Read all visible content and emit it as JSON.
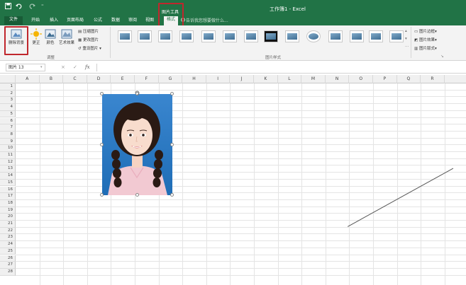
{
  "window": {
    "title": "工作簿1 - Excel",
    "context_tab_group": "图片工具"
  },
  "quick_access": {
    "save_icon": "save-icon",
    "undo_icon": "undo-icon",
    "redo_icon": "redo-icon",
    "more_icon": "dropdown-icon"
  },
  "tabs": {
    "file": "文件",
    "home": "开始",
    "insert": "插入",
    "layout": "页面布局",
    "formulas": "公式",
    "data": "数据",
    "review": "审阅",
    "view": "视图",
    "format": "格式"
  },
  "search_hint": "告诉我您想要做什么...",
  "ribbon": {
    "remove_bg": "删除背景",
    "corrections": "更正",
    "color": "颜色",
    "artistic": "艺术效果",
    "compress": "压缩图片",
    "change_picture": "更改图片",
    "reset_picture": "重设图片",
    "adjust_group": "调整",
    "styles_group": "图片样式",
    "border": "图片边框",
    "effects": "图片效果",
    "layout": "图片版式"
  },
  "formula_bar": {
    "name_box": "图片 13",
    "cancel": "×",
    "enter": "✓",
    "fx": "fx"
  },
  "columns": [
    "A",
    "B",
    "C",
    "D",
    "E",
    "F",
    "G",
    "H",
    "I",
    "J",
    "K",
    "L",
    "M",
    "N",
    "O",
    "P",
    "Q",
    "R"
  ],
  "rows": [
    "1",
    "2",
    "3",
    "4",
    "5",
    "6",
    "7",
    "8",
    "9",
    "10",
    "11",
    "12",
    "13",
    "14",
    "15",
    "16",
    "17",
    "18",
    "19",
    "20",
    "21",
    "22",
    "23",
    "24",
    "25",
    "26",
    "27",
    "28"
  ],
  "colors": {
    "excel_green": "#217346",
    "highlight_red": "#c0272d",
    "photo_bg": "#2c7bc7"
  }
}
